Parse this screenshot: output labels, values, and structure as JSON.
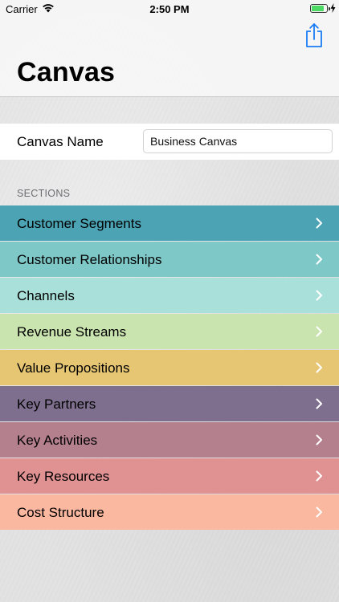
{
  "status_bar": {
    "carrier": "Carrier",
    "time": "2:50 PM",
    "battery_level": 0.85
  },
  "nav": {
    "title": "Canvas",
    "share_icon": "share-icon"
  },
  "canvas_name": {
    "label": "Canvas Name",
    "value": "Business Canvas"
  },
  "sections_header": "SECTIONS",
  "sections": [
    {
      "label": "Customer Segments",
      "color": "#4ba3b4"
    },
    {
      "label": "Customer Relationships",
      "color": "#7fc8c8"
    },
    {
      "label": "Channels",
      "color": "#a9e0d9"
    },
    {
      "label": "Revenue Streams",
      "color": "#c9e4ae"
    },
    {
      "label": "Value Propositions",
      "color": "#e6c673"
    },
    {
      "label": "Key Partners",
      "color": "#7e6f8e"
    },
    {
      "label": "Key Activities",
      "color": "#b4808e"
    },
    {
      "label": "Key Resources",
      "color": "#e09191"
    },
    {
      "label": "Cost Structure",
      "color": "#f9b89f"
    }
  ]
}
